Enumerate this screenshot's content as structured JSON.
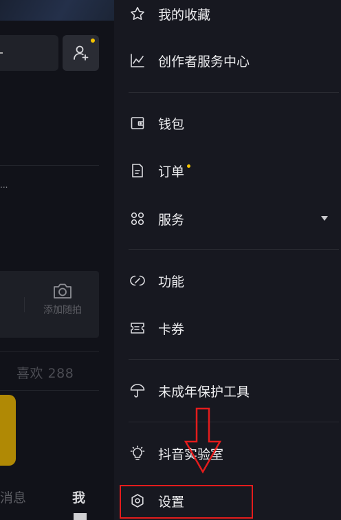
{
  "left_panel": {
    "ellipsis": "...",
    "camera_label": "添加随拍",
    "likes": "喜欢 288",
    "tabs": {
      "messages": "消息",
      "me": "我"
    }
  },
  "drawer": {
    "items": [
      {
        "label": "我的收藏",
        "icon": "star-icon"
      },
      {
        "label": "创作者服务中心",
        "icon": "chart-icon"
      },
      {
        "label": "钱包",
        "icon": "wallet-icon"
      },
      {
        "label": "订单",
        "icon": "order-icon"
      },
      {
        "label": "服务",
        "icon": "grid-icon"
      },
      {
        "label": "功能",
        "icon": "link-icon"
      },
      {
        "label": "卡券",
        "icon": "ticket-icon"
      },
      {
        "label": "未成年保护工具",
        "icon": "umbrella-icon"
      },
      {
        "label": "抖音实验室",
        "icon": "bulb-icon"
      },
      {
        "label": "设置",
        "icon": "gear-icon"
      }
    ]
  },
  "colors": {
    "accent_yellow": "#f5c400",
    "highlight_red": "#e41c1c",
    "drawer_bg": "#171820"
  }
}
